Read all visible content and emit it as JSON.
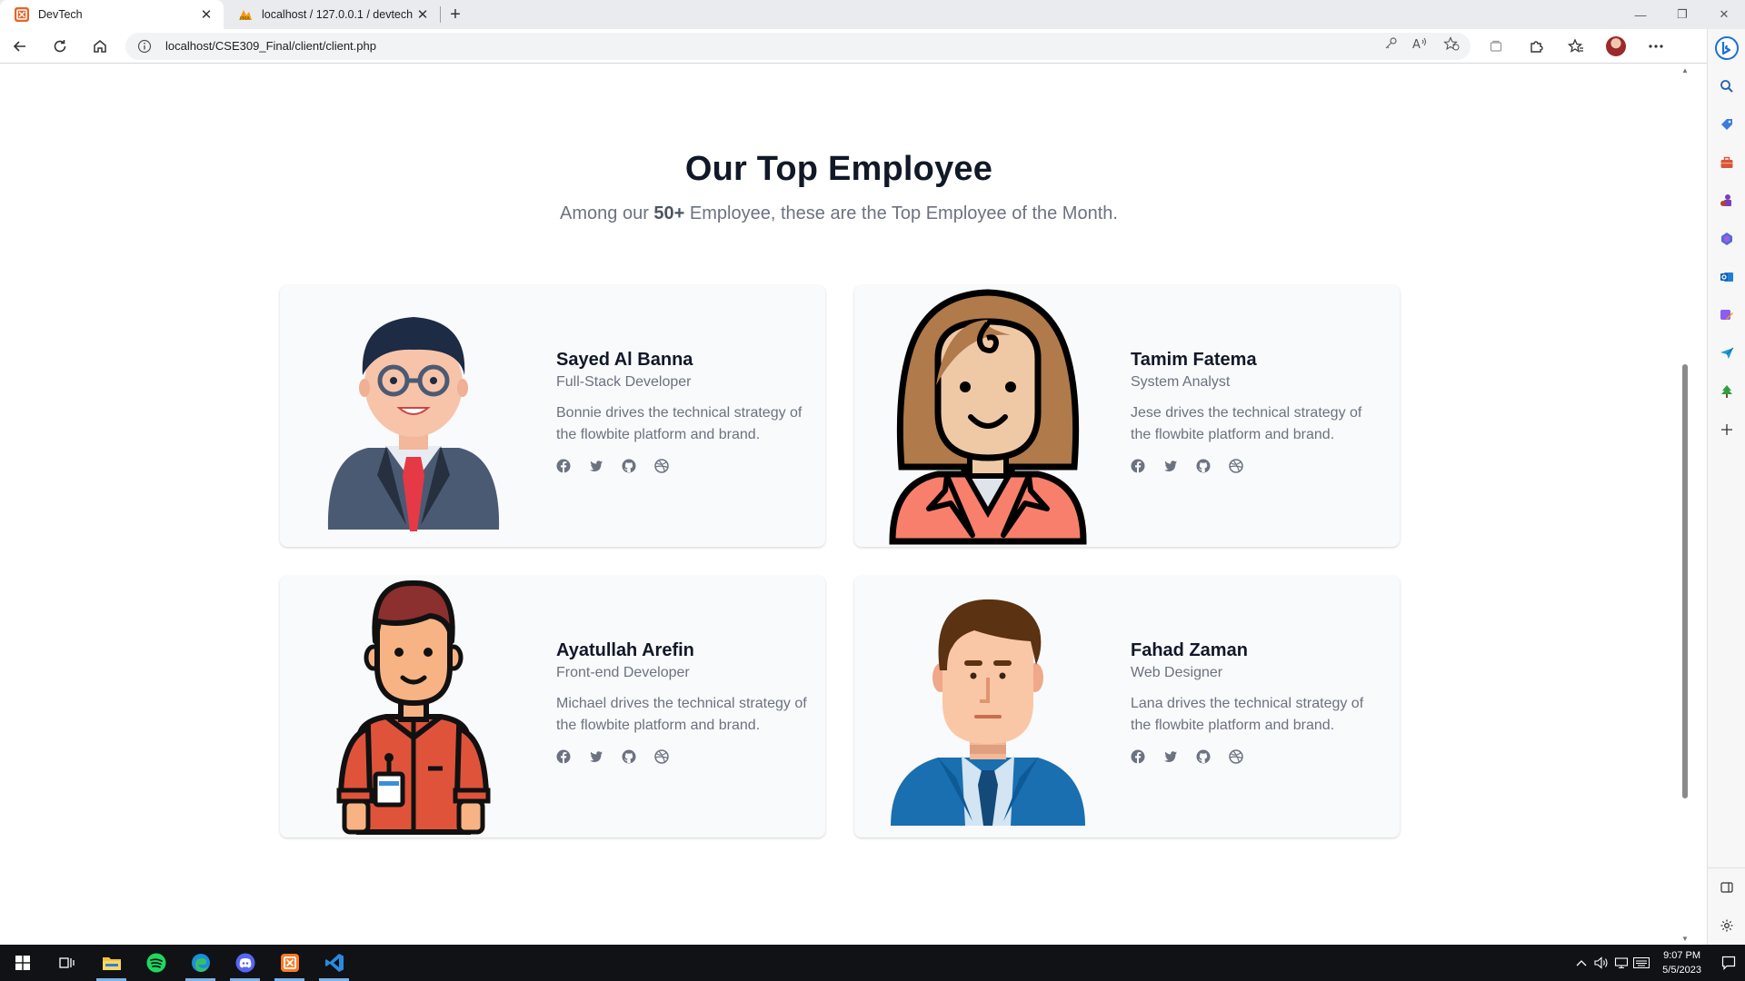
{
  "browser": {
    "tabs": [
      {
        "title": "DevTech",
        "active": true
      },
      {
        "title": "localhost / 127.0.0.1 / devtech / ",
        "active": false
      }
    ],
    "url": "localhost/CSE309_Final/client/client.php"
  },
  "page": {
    "heading": "Our Top Employee",
    "sub_prefix": "Among our ",
    "sub_count": "50+",
    "sub_suffix": " Employee, these are the Top Employee of the Month.",
    "employees": [
      {
        "name": "Sayed Al Banna",
        "role": "Full-Stack Developer",
        "desc": "Bonnie drives the technical strategy of the flowbite platform and brand."
      },
      {
        "name": "Tamim Fatema",
        "role": "System Analyst",
        "desc": "Jese drives the technical strategy of the flowbite platform and brand."
      },
      {
        "name": "Ayatullah Arefin",
        "role": "Front-end Developer",
        "desc": "Michael drives the technical strategy of the flowbite platform and brand."
      },
      {
        "name": "Fahad Zaman",
        "role": "Web Designer",
        "desc": "Lana drives the technical strategy of the flowbite platform and brand."
      }
    ],
    "social_icons": [
      "facebook-icon",
      "twitter-icon",
      "github-icon",
      "dribbble-icon"
    ]
  },
  "taskbar": {
    "time": "9:07 PM",
    "date": "5/5/2023",
    "apps": [
      "start-icon",
      "task-view-icon",
      "file-explorer-icon",
      "spotify-icon",
      "edge-icon",
      "discord-icon",
      "xampp-icon",
      "vscode-icon"
    ]
  },
  "colors": {
    "heading": "#111827",
    "muted_text": "#6b7280",
    "card_bg": "#f9fafb",
    "taskbar": "#101215"
  }
}
